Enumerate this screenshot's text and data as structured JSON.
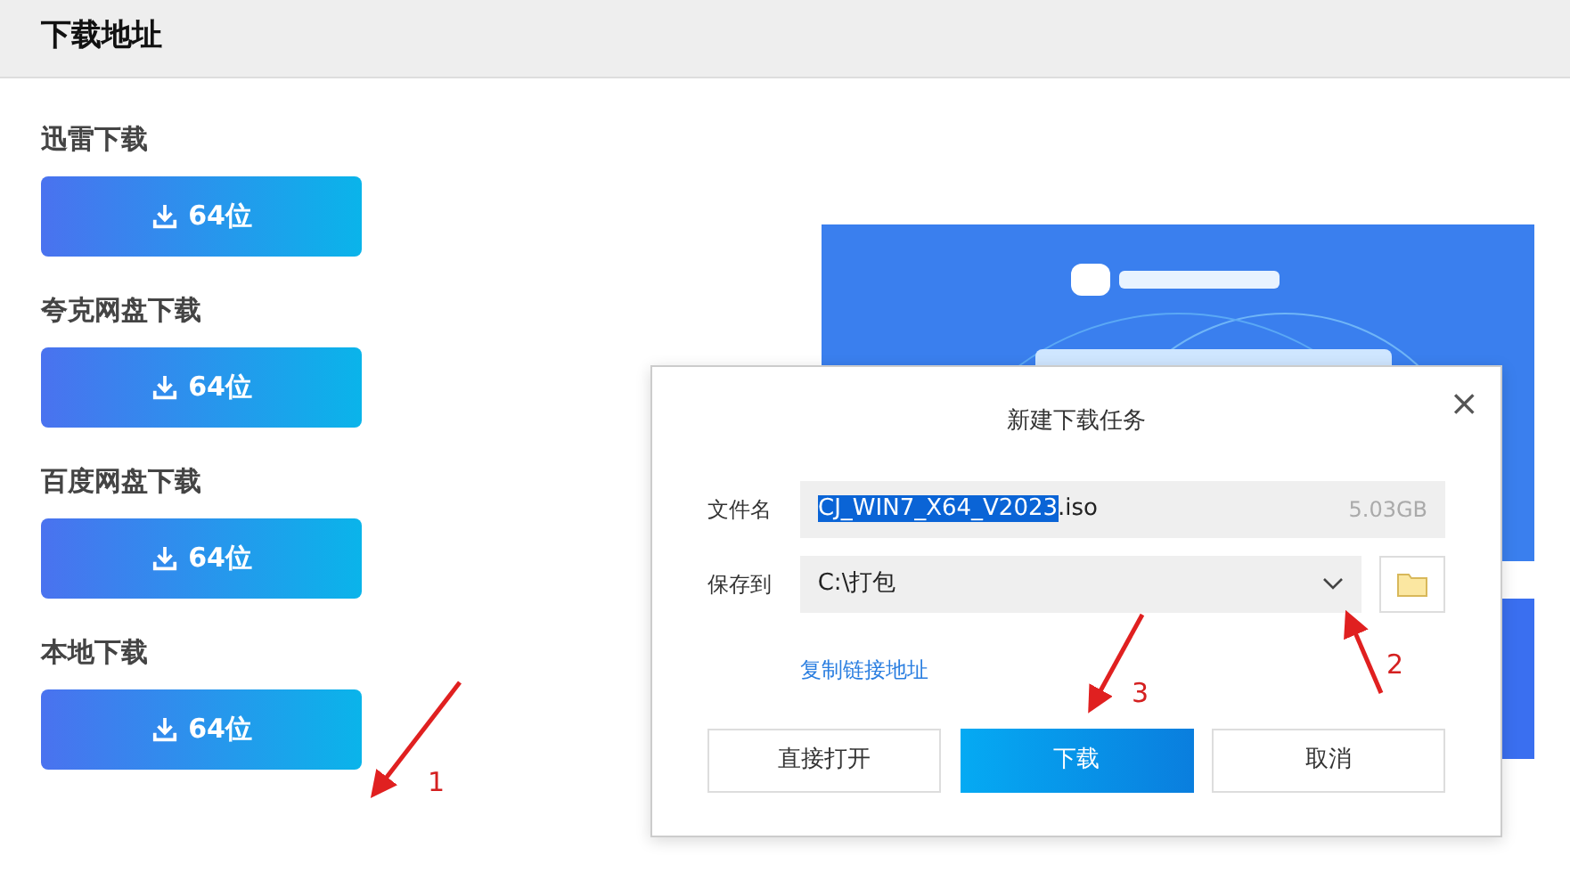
{
  "header": {
    "title": "下载地址"
  },
  "sections": [
    {
      "label": "迅雷下载",
      "button": "64位"
    },
    {
      "label": "夸克网盘下载",
      "button": "64位"
    },
    {
      "label": "百度网盘下载",
      "button": "64位"
    },
    {
      "label": "本地下载",
      "button": "64位"
    }
  ],
  "dialog": {
    "title": "新建下载任务",
    "close": "×",
    "filename_label": "文件名",
    "filename": {
      "selected_part": "CJ_WIN7_X64_V2023",
      "rest": ".iso"
    },
    "size": "5.03GB",
    "save_label": "保存到",
    "save_path": "C:\\打包",
    "link": "复制链接地址",
    "buttons": [
      {
        "label": "直接打开",
        "kind": "default"
      },
      {
        "label": "下载",
        "kind": "primary"
      },
      {
        "label": "取消",
        "kind": "default"
      }
    ]
  },
  "annotations": [
    {
      "number": "1"
    },
    {
      "number": "2"
    },
    {
      "number": "3"
    }
  ]
}
